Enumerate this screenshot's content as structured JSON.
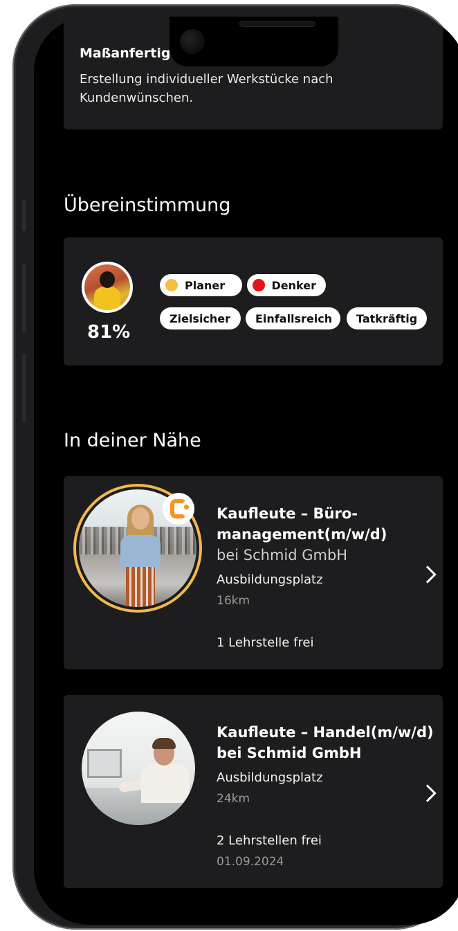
{
  "top_card": {
    "title": "Maßanfertig",
    "description": "Erstellung individueller Werkstücke nach Kundenwünschen."
  },
  "match_section": {
    "title": "Übereinstimmung",
    "percent": "81%",
    "profile_types": [
      {
        "label": "Planer",
        "dot_color": "#f7bd44"
      },
      {
        "label": "Denker",
        "dot_color": "#e8121b"
      }
    ],
    "traits": [
      "Zielsicher",
      "Einfallsreich",
      "Tatkräftig"
    ]
  },
  "nearby_section": {
    "title": "In deiner Nähe",
    "jobs": [
      {
        "title_line1": "Kaufleute – Büro-",
        "title_line2": "management(m/w/d)",
        "company": "bei Schmid GmbH",
        "type": "Ausbildungsplatz",
        "distance": "16km",
        "openings": "1 Lehrstelle frei",
        "ring_color": "#f1b84f",
        "badge_color": "#f7931e"
      },
      {
        "title_line1": "Kaufleute – Handel(m/w/d)",
        "company": "bei Schmid GmbH",
        "type": "Ausbildungsplatz",
        "distance": "24km",
        "openings": "2 Lehrstellen frei",
        "date": "01.09.2024"
      }
    ]
  }
}
